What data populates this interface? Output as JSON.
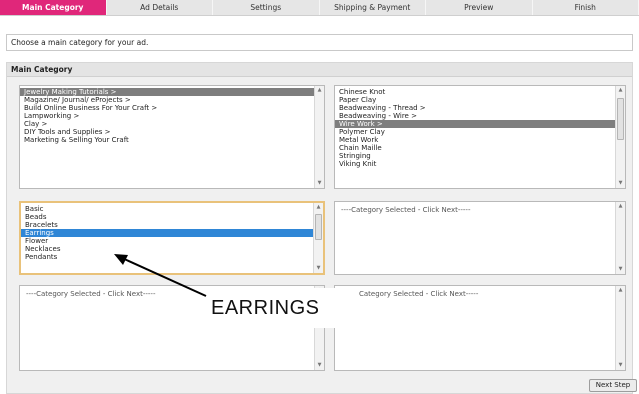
{
  "tabs": [
    "Main Category",
    "Ad Details",
    "Settings",
    "Shipping & Payment",
    "Preview",
    "Finish"
  ],
  "intro": "Choose a main category for your ad.",
  "panel": {
    "title": "Main Category"
  },
  "list_a": [
    "Jewelry Making Tutorials >",
    "Magazine/ Journal/ eProjects >",
    "Build Online Business For Your Craft >",
    "Lampworking >",
    "Clay >",
    "DIY Tools and Supplies >",
    "Marketing & Selling Your Craft"
  ],
  "list_b": [
    "Chinese Knot",
    "Paper Clay",
    "Beadweaving - Thread >",
    "Beadweaving - Wire >",
    "Wire Work >",
    "Polymer Clay",
    "Metal Work",
    "Chain Maille",
    "Stringing",
    "Viking Knit"
  ],
  "list_c": [
    "Basic",
    "Beads",
    "Bracelets",
    "Earrings",
    "Flower",
    "Necklaces",
    "Pendants"
  ],
  "placeholders": {
    "box_d": "----Category Selected - Click Next-----",
    "box_e": "----Category Selected - Click Next-----",
    "box_f": "Category Selected - Click Next-----"
  },
  "next_button": "Next Step",
  "callout": "EARRINGS",
  "colors": {
    "active_tab": "#e0277a",
    "selected_gray": "#7e7e7e",
    "selected_blue": "#2f86d6",
    "highlight_border": "#e9c27a"
  }
}
